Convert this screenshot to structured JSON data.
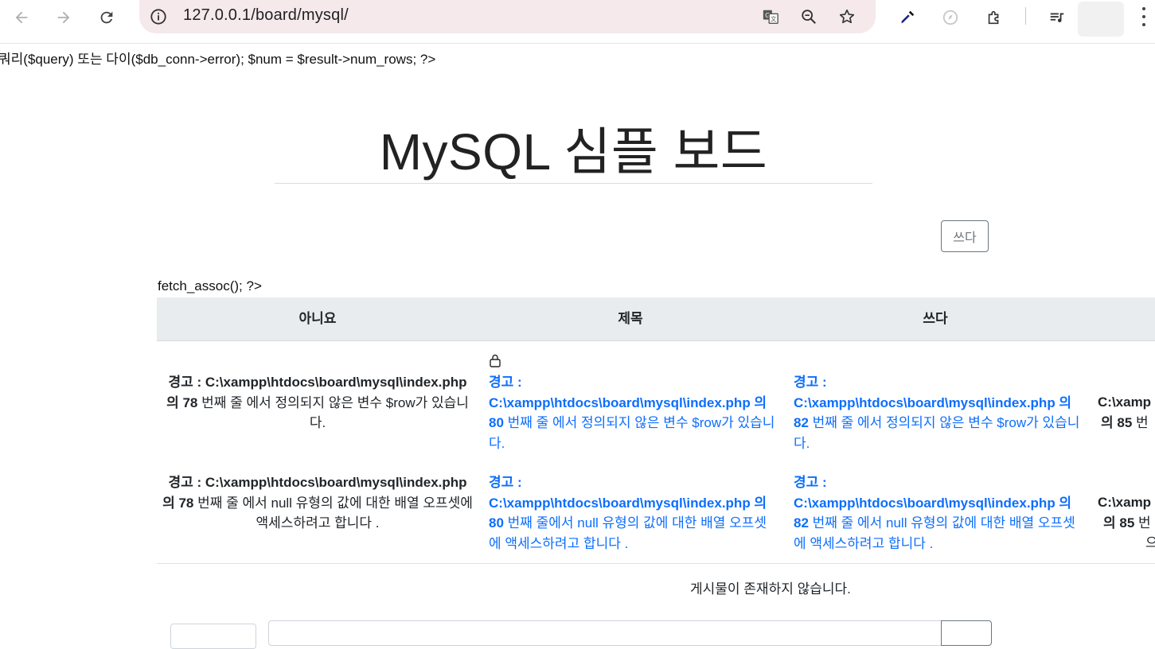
{
  "browser": {
    "url": "127.0.0.1/board/mysql/"
  },
  "raw_php_top": "쿼리($query) 또는 다이($db_conn->error); $num = $result->num_rows; ?>",
  "page_title": "MySQL 심플 보드",
  "write_button_label": "쓰다",
  "raw_php_fetch": "fetch_assoc(); ?>",
  "table": {
    "headers": [
      "아니요",
      "제목",
      "쓰다"
    ],
    "col1_row1": {
      "bold": "경고 : C:\\xampp\\htdocs\\board\\mysql\\index.php 의 78",
      "rest": " 번째 줄 에서 정의되지 않은 변수 $row가 있습니다."
    },
    "col1_row2": {
      "bold": "경고 : C:\\xampp\\htdocs\\board\\mysql\\index.php 의 78",
      "rest": " 번째 줄 에서 null 유형의 값에 대한 배열 오프셋에 액세스하려고 합니다 ."
    },
    "col2_row1": {
      "bold": "경고 : C:\\xampp\\htdocs\\board\\mysql\\index.php 의 80",
      "rest": " 번째 줄 에서 정의되지 않은 변수 $row가 있습니다."
    },
    "col2_row2": {
      "bold": "경고 : C:\\xampp\\htdocs\\board\\mysql\\index.php 의 80",
      "rest": " 번째 줄에서 null 유형의 값에 대한 배열 오프셋에 액세스하려고 합니다 ."
    },
    "col3_row1": {
      "bold": "경고 : C:\\xampp\\htdocs\\board\\mysql\\index.php 의 82",
      "rest": " 번째 줄 에서 정의되지 않은 변수 $row가 있습니다."
    },
    "col3_row2": {
      "bold": "경고 : C:\\xampp\\htdocs\\board\\mysql\\index.php 의 82",
      "rest": " 번째 줄 에서 null 유형의 값에 대한 배열 오프셋에 액세스하려고 합니다 ."
    },
    "col4_row1_l1": "C:\\xamp",
    "col4_row1_l2_bold": "의 85",
    "col4_row1_l2_rest": " 번",
    "col4_row2_l1": "C:\\xamp",
    "col4_row2_l2_bold": "의 85",
    "col4_row2_l2_rest": " 번",
    "col4_row2_l3": "으"
  },
  "empty_message": "게시물이 존재하지 않습니다.",
  "colors": {
    "link_blue": "#0d6efd",
    "table_header_bg": "#e9ecef",
    "omnibox_bg": "#f5e9ec"
  }
}
